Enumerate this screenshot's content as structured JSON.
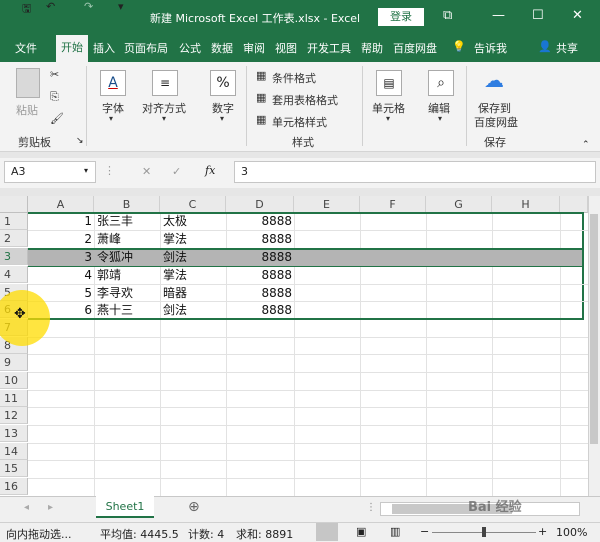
{
  "title_bar": {
    "title": "新建 Microsoft Excel 工作表.xlsx  -  Excel",
    "login": "登录",
    "qat": {
      "save": "🖫",
      "undo": "↶",
      "redo": "↷",
      "customize": "▾"
    },
    "controls": {
      "ribbon_options": "⧉",
      "minimize": "—",
      "maximize": "☐",
      "close": "✕"
    }
  },
  "tabs": [
    "文件",
    "开始",
    "插入",
    "页面布局",
    "公式",
    "数据",
    "审阅",
    "视图",
    "开发工具",
    "帮助",
    "百度网盘"
  ],
  "tell_me": "告诉我",
  "share": "共享",
  "ribbon": {
    "clipboard": {
      "paste": "粘贴",
      "label": "剪贴板"
    },
    "font": "字体",
    "alignment": "对齐方式",
    "number": "数字",
    "styles": {
      "conditional": "条件格式",
      "table": "套用表格格式",
      "cell_styles": "单元格样式",
      "label": "样式"
    },
    "cells": "单元格",
    "editing": "编辑",
    "save": {
      "line1": "保存到",
      "line2": "百度网盘",
      "label": "保存"
    }
  },
  "formula_bar": {
    "name_box": "A3",
    "fx": "fx",
    "value": "3"
  },
  "columns": [
    "A",
    "B",
    "C",
    "D",
    "E",
    "F",
    "G",
    "H"
  ],
  "rows": [
    "1",
    "2",
    "3",
    "4",
    "5",
    "6",
    "7",
    "8",
    "9",
    "10",
    "11",
    "12",
    "13",
    "14",
    "15",
    "16"
  ],
  "data": [
    {
      "num": "1",
      "name": "张三丰",
      "skill": "太极",
      "value": "8888"
    },
    {
      "num": "2",
      "name": "萧峰",
      "skill": "掌法",
      "value": "8888"
    },
    {
      "num": "3",
      "name": "令狐冲",
      "skill": "剑法",
      "value": "8888"
    },
    {
      "num": "4",
      "name": "郭靖",
      "skill": "掌法",
      "value": "8888"
    },
    {
      "num": "5",
      "name": "李寻欢",
      "skill": "暗器",
      "value": "8888"
    },
    {
      "num": "6",
      "name": "燕十三",
      "skill": "剑法",
      "value": "8888"
    }
  ],
  "sheet_tab": "Sheet1",
  "add_sheet": "⊕",
  "status": {
    "mode": "向内拖动选...",
    "average": "平均值: 4445.5",
    "count": "计数: 4",
    "sum": "求和: 8891",
    "zoom": "100%"
  },
  "watermark": "Bai 经验",
  "colors": {
    "accent": "#217346",
    "selection": "#b4b4b4"
  }
}
